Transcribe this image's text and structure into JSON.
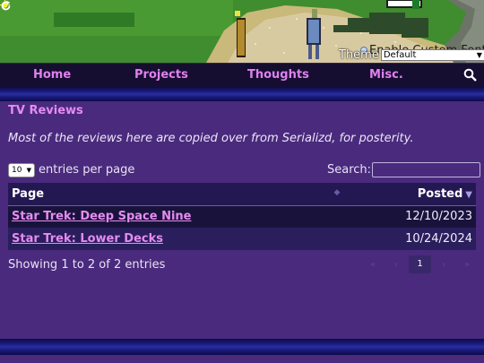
{
  "header": {
    "enable_fonts_label": "Enable Custom Fonts",
    "theme_label": "Theme",
    "theme_value": "Default",
    "icons": [
      "sun-icon",
      "refresh-icon"
    ]
  },
  "nav": {
    "items": [
      {
        "label": "Home"
      },
      {
        "label": "Projects"
      },
      {
        "label": "Thoughts"
      },
      {
        "label": "Misc."
      }
    ],
    "search_icon": "search-icon"
  },
  "main": {
    "title": "TV Reviews",
    "intro": "Most of the reviews here are copied over from Serializd, for posterity.",
    "length": {
      "value": "10",
      "suffix": "entries per page"
    },
    "search_label": "Search:",
    "search_value": "",
    "table": {
      "columns": [
        "Page",
        "Posted"
      ],
      "rows": [
        {
          "page": "Star Trek: Deep Space Nine",
          "posted": "12/10/2023"
        },
        {
          "page": "Star Trek: Lower Decks",
          "posted": "10/24/2024"
        }
      ]
    },
    "info": "Showing 1 to 2 of 2 entries",
    "pager": {
      "first": "«",
      "prev": "‹",
      "current": "1",
      "next": "›",
      "last": "»"
    }
  },
  "colors": {
    "accent": "#e58cf0",
    "background": "#4a2a7d",
    "nav_bg": "#160e30"
  }
}
